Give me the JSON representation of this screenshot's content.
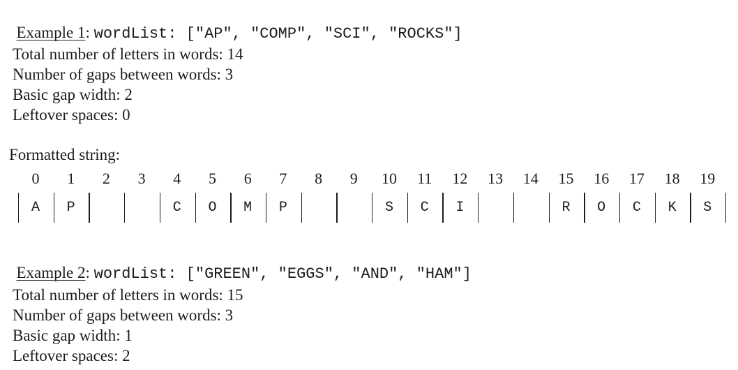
{
  "example1": {
    "label": "Example 1",
    "colon": ": ",
    "code": "wordList: [\"AP\", \"COMP\", \"SCI\", \"ROCKS\"]",
    "words": [
      "AP",
      "COMP",
      "SCI",
      "ROCKS"
    ],
    "stats": [
      "Total number of letters in words: 14",
      "Number of gaps between words: 3",
      "Basic gap width: 2",
      "Leftover spaces: 0"
    ],
    "formatted_label": "Formatted string:",
    "indices": [
      "0",
      "1",
      "2",
      "3",
      "4",
      "5",
      "6",
      "7",
      "8",
      "9",
      "10",
      "11",
      "12",
      "13",
      "14",
      "15",
      "16",
      "17",
      "18",
      "19"
    ],
    "cells": [
      "A",
      "P",
      "",
      "",
      "C",
      "O",
      "M",
      "P",
      "",
      "",
      "S",
      "C",
      "I",
      "",
      "",
      "R",
      "O",
      "C",
      "K",
      "S"
    ]
  },
  "example2": {
    "label": "Example 2",
    "colon": ": ",
    "code": "wordList: [\"GREEN\", \"EGGS\", \"AND\", \"HAM\"]",
    "words": [
      "GREEN",
      "EGGS",
      "AND",
      "HAM"
    ],
    "stats": [
      "Total number of letters in words: 15",
      "Number of gaps between words: 3",
      "Basic gap width: 1",
      "Leftover spaces: 2"
    ]
  }
}
